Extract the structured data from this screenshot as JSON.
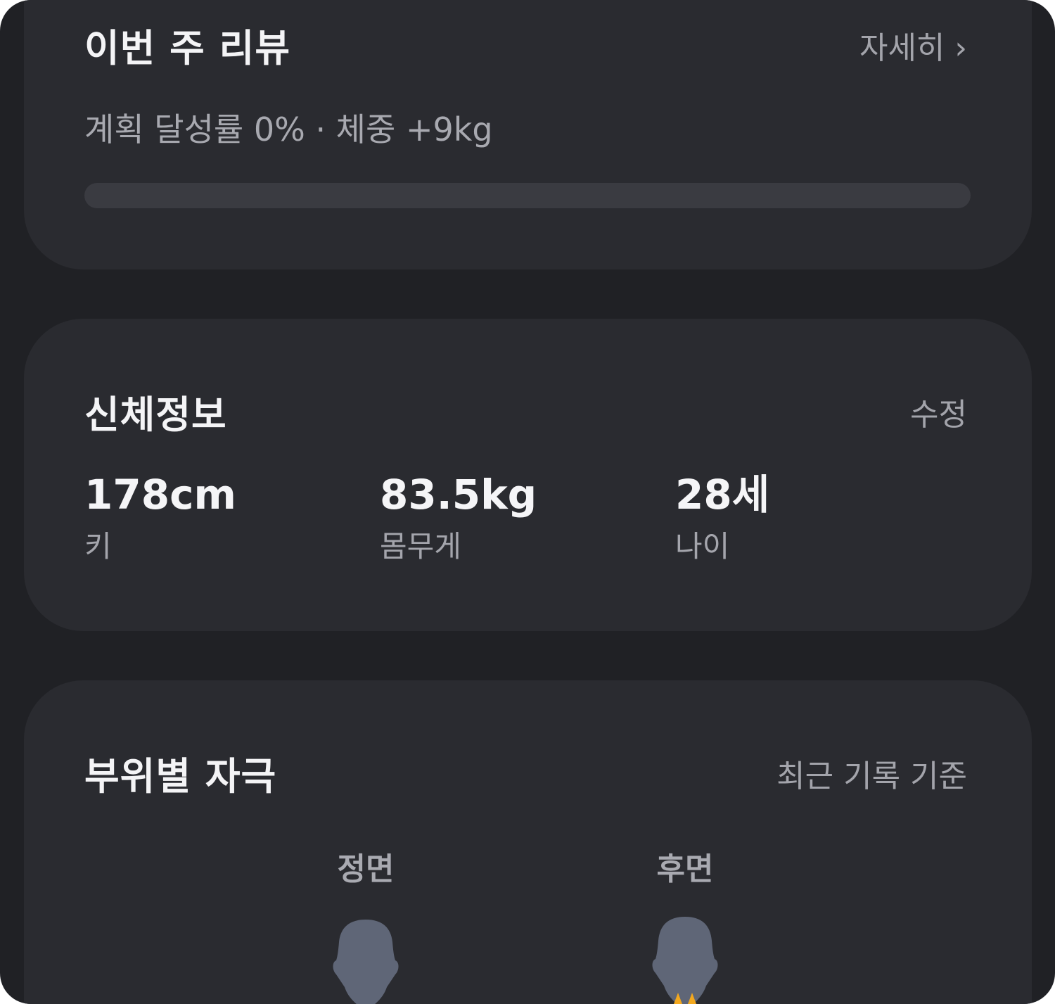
{
  "weekly_review": {
    "title": "이번 주 리뷰",
    "detail_link": "자세히 ›",
    "summary": "계획 달성률 0% · 체중 +9kg",
    "plan_progress_percent": 0
  },
  "body_info": {
    "title": "신체정보",
    "edit_link": "수정",
    "stats": [
      {
        "value": "178cm",
        "label": "키"
      },
      {
        "value": "83.5kg",
        "label": "몸무게"
      },
      {
        "value": "28세",
        "label": "나이"
      }
    ]
  },
  "muscle_stimulus": {
    "title": "부위별 자극",
    "basis_note": "최근 기록 기준",
    "front_label": "정면",
    "back_label": "후면",
    "colors": {
      "body": "#5f6677",
      "highlight": "#f3a81f"
    }
  },
  "theme": {
    "background": "#202125",
    "card": "#2a2b30",
    "track": "#3a3b41"
  }
}
